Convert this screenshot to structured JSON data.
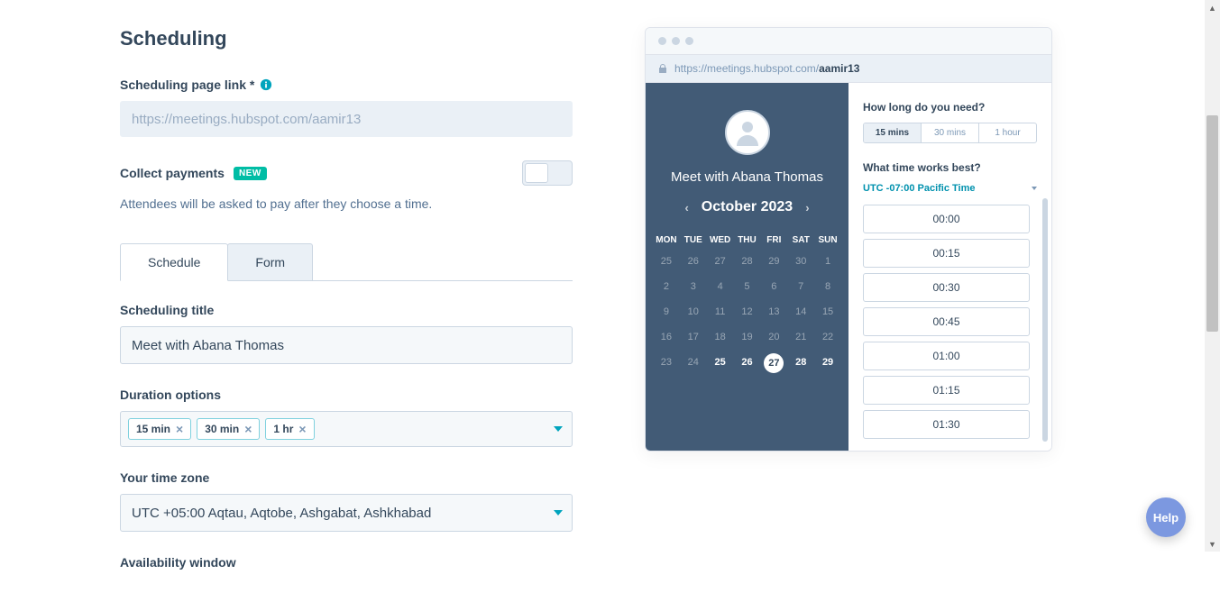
{
  "page_title": "Scheduling",
  "link_field": {
    "label": "Scheduling page link *",
    "value": "https://meetings.hubspot.com/aamir13"
  },
  "payments": {
    "label": "Collect payments",
    "badge": "NEW",
    "helper": "Attendees will be asked to pay after they choose a time."
  },
  "tabs": {
    "schedule": "Schedule",
    "form": "Form"
  },
  "title_field": {
    "label": "Scheduling title",
    "value": "Meet with Abana Thomas"
  },
  "duration_field": {
    "label": "Duration options",
    "chips": [
      "15 min",
      "30 min",
      "1 hr"
    ]
  },
  "timezone_field": {
    "label": "Your time zone",
    "value": "UTC +05:00 Aqtau, Aqtobe, Ashgabat, Ashkhabad"
  },
  "availability_field": {
    "label": "Availability window"
  },
  "preview": {
    "url_prefix": "https://meetings.hubspot.com/",
    "url_slug": "aamir13",
    "meet_title": "Meet with Abana Thomas",
    "month": "October 2023",
    "dow": [
      "MON",
      "TUE",
      "WED",
      "THU",
      "FRI",
      "SAT",
      "SUN"
    ],
    "weeks": [
      [
        {
          "d": "25"
        },
        {
          "d": "26"
        },
        {
          "d": "27"
        },
        {
          "d": "28"
        },
        {
          "d": "29"
        },
        {
          "d": "30"
        },
        {
          "d": "1"
        }
      ],
      [
        {
          "d": "2"
        },
        {
          "d": "3"
        },
        {
          "d": "4"
        },
        {
          "d": "5"
        },
        {
          "d": "6"
        },
        {
          "d": "7"
        },
        {
          "d": "8"
        }
      ],
      [
        {
          "d": "9"
        },
        {
          "d": "10"
        },
        {
          "d": "11"
        },
        {
          "d": "12"
        },
        {
          "d": "13"
        },
        {
          "d": "14"
        },
        {
          "d": "15"
        }
      ],
      [
        {
          "d": "16"
        },
        {
          "d": "17"
        },
        {
          "d": "18"
        },
        {
          "d": "19"
        },
        {
          "d": "20"
        },
        {
          "d": "21"
        },
        {
          "d": "22"
        }
      ],
      [
        {
          "d": "23"
        },
        {
          "d": "24"
        },
        {
          "d": "25",
          "a": true
        },
        {
          "d": "26",
          "a": true
        },
        {
          "d": "27",
          "a": true,
          "sel": true
        },
        {
          "d": "28",
          "a": true
        },
        {
          "d": "29",
          "a": true
        }
      ]
    ],
    "how_long_label": "How long do you need?",
    "durations": [
      "15 mins",
      "30 mins",
      "1 hour"
    ],
    "what_time_label": "What time works best?",
    "timezone": "UTC -07:00 Pacific Time",
    "slots": [
      "00:00",
      "00:15",
      "00:30",
      "00:45",
      "01:00",
      "01:15",
      "01:30"
    ]
  },
  "help_label": "Help"
}
